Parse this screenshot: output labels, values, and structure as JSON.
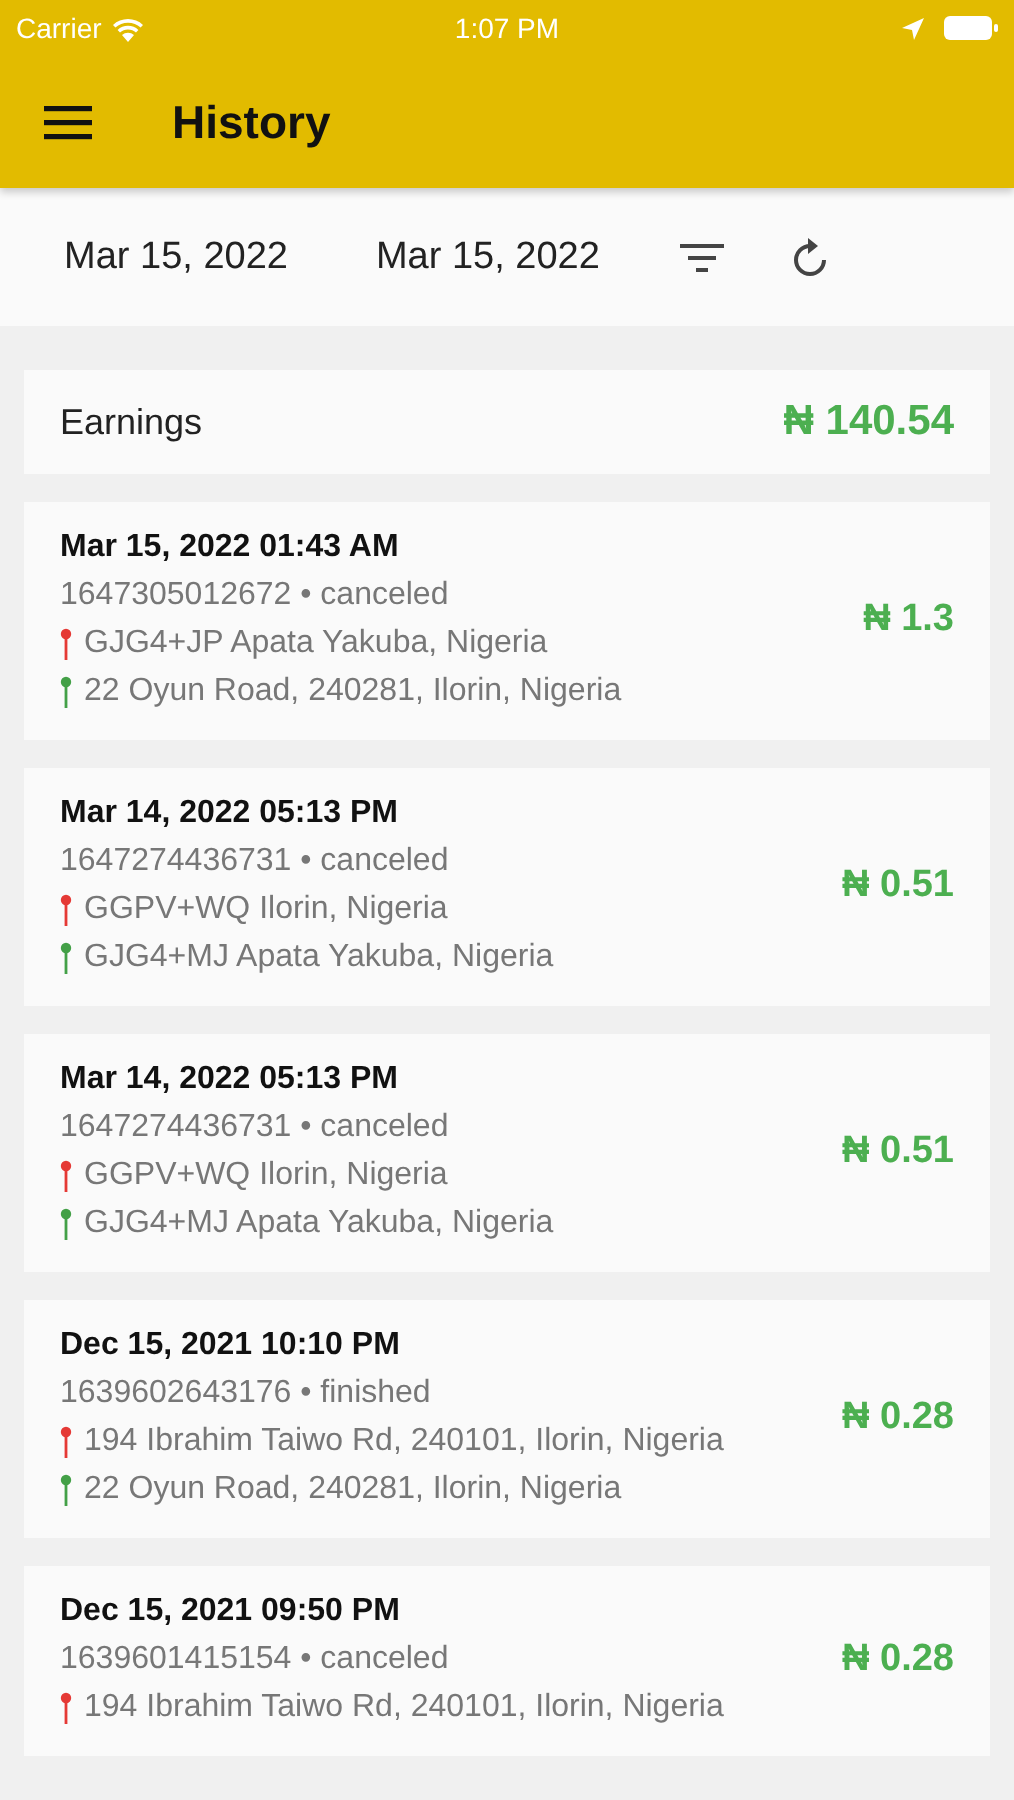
{
  "status_bar": {
    "carrier": "Carrier",
    "time": "1:07 PM"
  },
  "header": {
    "title": "History"
  },
  "date_range": {
    "from": "Mar 15, 2022",
    "to": "Mar 15, 2022"
  },
  "earnings": {
    "label": "Earnings",
    "amount": "₦ 140.54"
  },
  "trips": [
    {
      "datetime": "Mar 15, 2022 01:43 AM",
      "id_status": "1647305012672 • canceled",
      "pickup": "GJG4+JP Apata Yakuba, Nigeria",
      "dropoff": "22 Oyun Road, 240281, Ilorin, Nigeria",
      "fare": "₦ 1.3"
    },
    {
      "datetime": "Mar 14, 2022 05:13 PM",
      "id_status": "1647274436731 • canceled",
      "pickup": "GGPV+WQ Ilorin, Nigeria",
      "dropoff": "GJG4+MJ Apata Yakuba, Nigeria",
      "fare": "₦ 0.51"
    },
    {
      "datetime": "Mar 14, 2022 05:13 PM",
      "id_status": "1647274436731 • canceled",
      "pickup": "GGPV+WQ Ilorin, Nigeria",
      "dropoff": "GJG4+MJ Apata Yakuba, Nigeria",
      "fare": "₦ 0.51"
    },
    {
      "datetime": "Dec 15, 2021 10:10 PM",
      "id_status": "1639602643176 • finished",
      "pickup": "194 Ibrahim Taiwo Rd, 240101, Ilorin, Nigeria",
      "dropoff": "22 Oyun Road, 240281, Ilorin, Nigeria",
      "fare": "₦ 0.28"
    },
    {
      "datetime": "Dec 15, 2021 09:50 PM",
      "id_status": "1639601415154 • canceled",
      "pickup": "194 Ibrahim Taiwo Rd, 240101, Ilorin, Nigeria",
      "fare": "₦ 0.28"
    }
  ]
}
